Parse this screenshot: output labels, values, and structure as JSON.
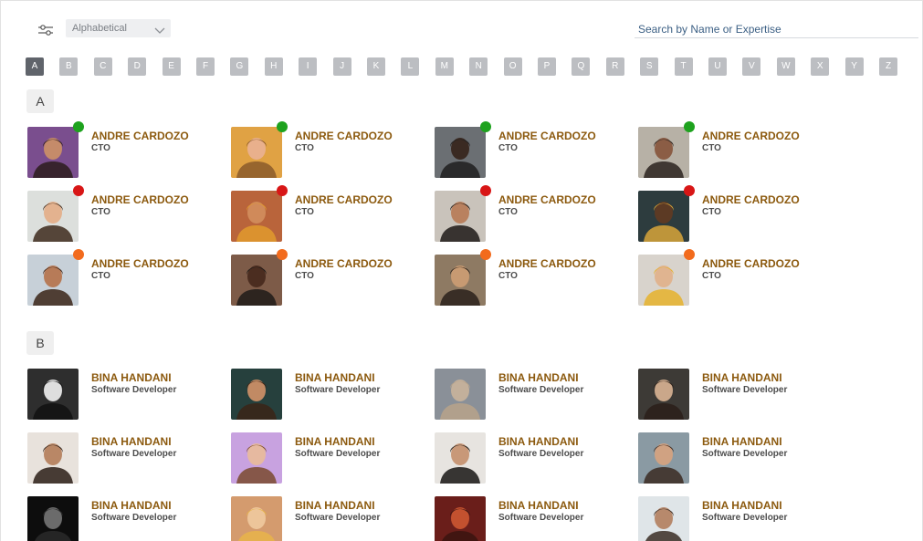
{
  "toolbar": {
    "sort_value": "Alphabetical",
    "search_placeholder": "Search by Name or Expertise"
  },
  "alphabet": {
    "active": "A",
    "letters": [
      "A",
      "B",
      "C",
      "D",
      "E",
      "F",
      "G",
      "H",
      "I",
      "J",
      "K",
      "L",
      "M",
      "N",
      "O",
      "P",
      "Q",
      "R",
      "S",
      "T",
      "U",
      "V",
      "W",
      "X",
      "Y",
      "Z"
    ]
  },
  "colors": {
    "accent_name": "#8c5a0f",
    "status_online": "#1ea21e",
    "status_busy": "#d81616",
    "status_away": "#f26b1d",
    "letter_active": "#60646b",
    "letter_inactive": "#bcbec2"
  },
  "sections": [
    {
      "letter": "A",
      "people": [
        {
          "name": "ANDRE CARDOZO",
          "role": "CTO",
          "status": "online",
          "icon": "person-photo"
        },
        {
          "name": "ANDRE CARDOZO",
          "role": "CTO",
          "status": "online",
          "icon": "person-photo"
        },
        {
          "name": "ANDRE CARDOZO",
          "role": "CTO",
          "status": "online",
          "icon": "person-photo"
        },
        {
          "name": "ANDRE CARDOZO",
          "role": "CTO",
          "status": "online",
          "icon": "person-photo"
        },
        {
          "name": "ANDRE CARDOZO",
          "role": "CTO",
          "status": "busy",
          "icon": "person-photo"
        },
        {
          "name": "ANDRE CARDOZO",
          "role": "CTO",
          "status": "busy",
          "icon": "person-photo"
        },
        {
          "name": "ANDRE CARDOZO",
          "role": "CTO",
          "status": "busy",
          "icon": "person-photo"
        },
        {
          "name": "ANDRE CARDOZO",
          "role": "CTO",
          "status": "busy",
          "icon": "person-photo"
        },
        {
          "name": "ANDRE CARDOZO",
          "role": "CTO",
          "status": "away",
          "icon": "person-photo"
        },
        {
          "name": "ANDRE CARDOZO",
          "role": "CTO",
          "status": "away",
          "icon": "person-photo"
        },
        {
          "name": "ANDRE CARDOZO",
          "role": "CTO",
          "status": "away",
          "icon": "person-photo"
        },
        {
          "name": "ANDRE CARDOZO",
          "role": "CTO",
          "status": "away",
          "icon": "person-photo"
        }
      ]
    },
    {
      "letter": "B",
      "people": [
        {
          "name": "BINA HANDANI",
          "role": "Software Developer",
          "status": "",
          "icon": "person-photo"
        },
        {
          "name": "BINA HANDANI",
          "role": "Software Developer",
          "status": "",
          "icon": "person-photo"
        },
        {
          "name": "BINA HANDANI",
          "role": "Software Developer",
          "status": "",
          "icon": "person-photo"
        },
        {
          "name": "BINA HANDANI",
          "role": "Software Developer",
          "status": "",
          "icon": "person-photo"
        },
        {
          "name": "BINA HANDANI",
          "role": "Software Developer",
          "status": "",
          "icon": "person-photo"
        },
        {
          "name": "BINA HANDANI",
          "role": "Software Developer",
          "status": "",
          "icon": "person-photo"
        },
        {
          "name": "BINA HANDANI",
          "role": "Software Developer",
          "status": "",
          "icon": "person-photo"
        },
        {
          "name": "BINA HANDANI",
          "role": "Software Developer",
          "status": "",
          "icon": "person-photo"
        },
        {
          "name": "BINA HANDANI",
          "role": "Software Developer",
          "status": "",
          "icon": "person-photo"
        },
        {
          "name": "BINA HANDANI",
          "role": "Software Developer",
          "status": "",
          "icon": "person-photo"
        },
        {
          "name": "BINA HANDANI",
          "role": "Software Developer",
          "status": "",
          "icon": "person-photo"
        },
        {
          "name": "BINA HANDANI",
          "role": "Software Developer",
          "status": "",
          "icon": "person-photo"
        }
      ]
    }
  ]
}
